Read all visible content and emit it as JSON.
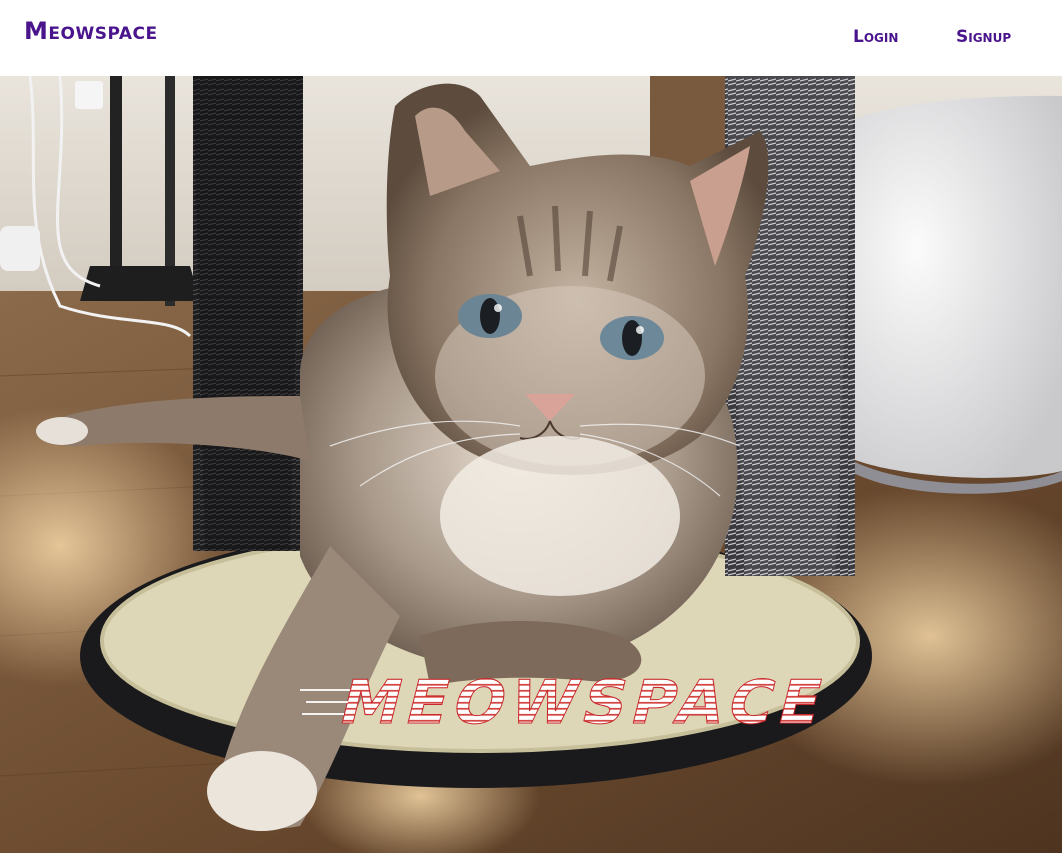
{
  "navbar": {
    "brand": "Meowspace",
    "links": [
      {
        "label": "Login"
      },
      {
        "label": "Signup"
      }
    ]
  },
  "hero": {
    "title": "MEOWSPACE",
    "image_subject": "tabby cat lying on a scratching post base between two brush posts on a wooden floor"
  },
  "colors": {
    "brand": "#4a148c",
    "hero_title_fill": "#ffffff",
    "hero_title_stripes": "#d0312d"
  }
}
